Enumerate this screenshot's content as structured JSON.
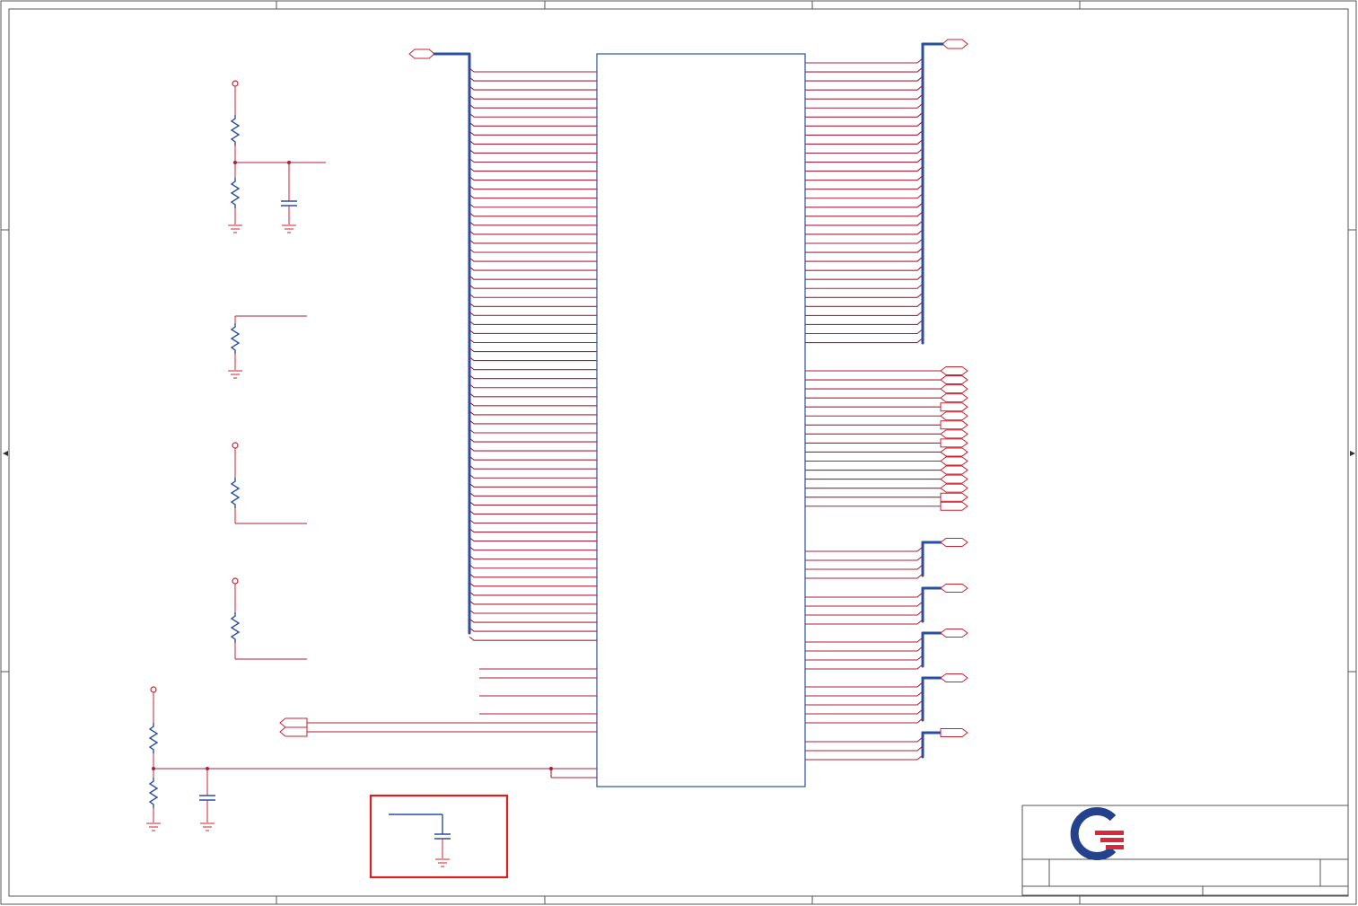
{
  "diagram": {
    "type": "schematic",
    "colors": {
      "wire": "#a8203a",
      "net": "#cc2233",
      "bus": "#2a4fa0",
      "component": "#2a4fa0",
      "frame": "#555555",
      "highlight": "#e02020"
    },
    "ic_left_pins": 64,
    "ic_left_misc_pins": 7,
    "ic_right_bus_pins": 32,
    "ic_right_signal_ports": 16,
    "right_bus_groups": [
      4,
      4,
      4,
      5,
      3
    ],
    "icons": [
      "resistor-icon",
      "capacitor-icon",
      "ground-icon",
      "power-icon",
      "port-icon",
      "company-logo-icon"
    ]
  }
}
